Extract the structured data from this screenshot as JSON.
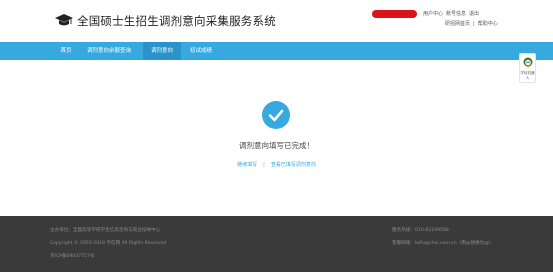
{
  "header": {
    "title": "全国硕士生招生调剂意向采集服务系统",
    "links_row1": [
      "用户中心",
      "账号信息",
      "退出"
    ],
    "links_row2": [
      "研招网首页",
      "帮助中心"
    ],
    "separator": "|"
  },
  "nav": {
    "items": [
      {
        "label": "首页",
        "active": false
      },
      {
        "label": "调剂意向余额查询",
        "active": false
      },
      {
        "label": "调剂意向",
        "active": true
      },
      {
        "label": "初试成绩",
        "active": false
      }
    ]
  },
  "side_widget": {
    "label": "学信机器人"
  },
  "main": {
    "success_text": "调剂意向填写已完成！",
    "link_continue": "继续填写",
    "link_view": "查看已填写调剂意向",
    "link_separator": "|"
  },
  "footer": {
    "host": "主办单位：全国高等学校学生信息咨询与就业指导中心",
    "copyright": "Copyright © 2003-2018 学信网 All Rights Reserved",
    "icp": "京ICP备09037757号",
    "phone": "服务热线：010-82199588",
    "email": "客服邮箱：kefu@chsi.com.cn（用@替换为@）"
  },
  "colors": {
    "accent": "#36a9e1",
    "accent_active": "#2a93c9",
    "footer_bg": "#3a3a3a"
  }
}
